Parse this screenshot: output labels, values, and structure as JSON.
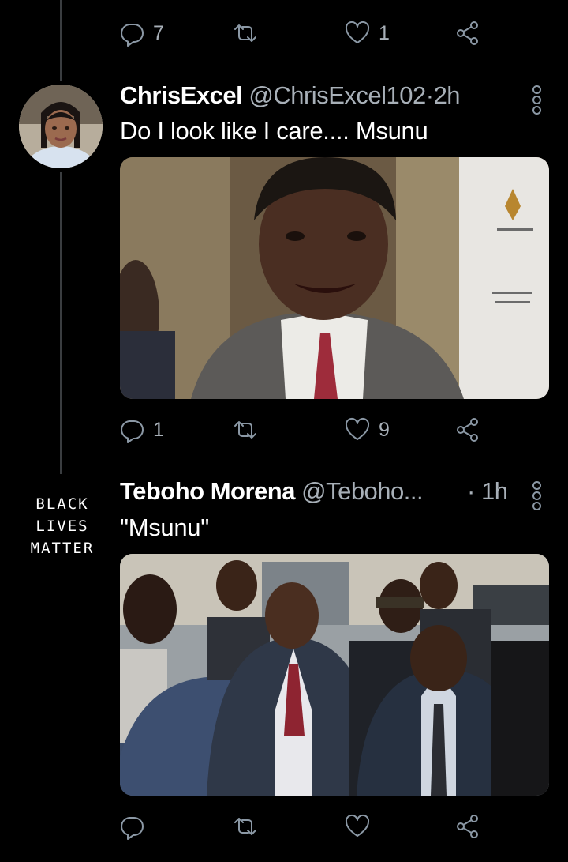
{
  "prev_tweet": {
    "reply_count": "7",
    "retweet_count": "",
    "like_count": "1"
  },
  "tweet1": {
    "display_name": "ChrisExcel",
    "handle": "@ChrisExcel102",
    "separator": "·",
    "time": "2h",
    "text": "Do I look like I care.... Msunu",
    "reply_count": "1",
    "retweet_count": "",
    "like_count": "9"
  },
  "tweet2": {
    "display_name": "Teboho Morena",
    "handle": "@Teboho...",
    "separator": "·",
    "time": "1h",
    "text": "\"Msunu\"",
    "avatar_text": [
      "BLACK",
      "LIVES",
      "MATTER"
    ],
    "reply_count": "",
    "retweet_count": "",
    "like_count": ""
  },
  "colors": {
    "background": "#000000",
    "text_primary": "#ffffff",
    "text_secondary": "#a8b0b8",
    "icon": "#8b98a5",
    "thread_line": "#3a3d40"
  },
  "icons": {
    "reply": "speech-bubble-icon",
    "retweet": "retweet-arrows-icon",
    "like": "heart-icon",
    "share": "share-nodes-icon",
    "more": "vertical-dots-icon"
  }
}
